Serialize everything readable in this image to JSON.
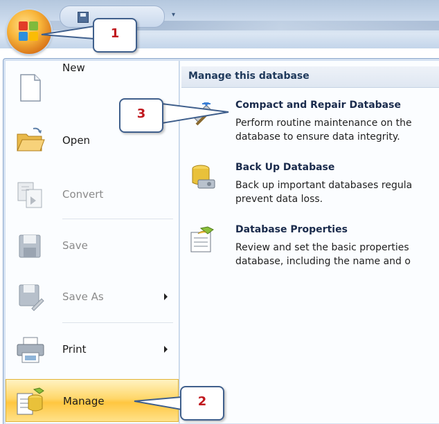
{
  "menu_left": {
    "items": [
      {
        "label": "New",
        "state": "enabled",
        "icon": "new-document-icon"
      },
      {
        "label": "Open",
        "state": "enabled",
        "icon": "open-folder-icon"
      },
      {
        "label": "Convert",
        "state": "disabled",
        "icon": "convert-icon"
      },
      {
        "label": "Save",
        "state": "disabled",
        "icon": "save-icon"
      },
      {
        "label": "Save As",
        "state": "disabled",
        "icon": "save-as-icon",
        "submenu": true
      },
      {
        "label": "Print",
        "state": "enabled",
        "icon": "printer-icon",
        "submenu": true
      },
      {
        "label": "Manage",
        "state": "selected",
        "icon": "manage-icon"
      }
    ]
  },
  "menu_right": {
    "header": "Manage this database",
    "options": [
      {
        "title": "Compact and Repair Database",
        "description": "Perform routine maintenance on the\ndatabase to ensure data integrity.",
        "icon": "compact-repair-icon"
      },
      {
        "title": "Back Up Database",
        "description": "Back up important databases regula\nprevent data loss.",
        "icon": "backup-database-icon"
      },
      {
        "title": "Database Properties",
        "description": "Review and set the basic properties\ndatabase, including the name and o",
        "icon": "database-properties-icon"
      }
    ]
  },
  "callouts": [
    {
      "number": "1"
    },
    {
      "number": "2"
    },
    {
      "number": "3"
    }
  ],
  "colors": {
    "selected_item_gradient": "#ffd76a",
    "header_text": "#1e395b",
    "callout_number": "#c0181e",
    "callout_border": "#3f5f8c"
  }
}
